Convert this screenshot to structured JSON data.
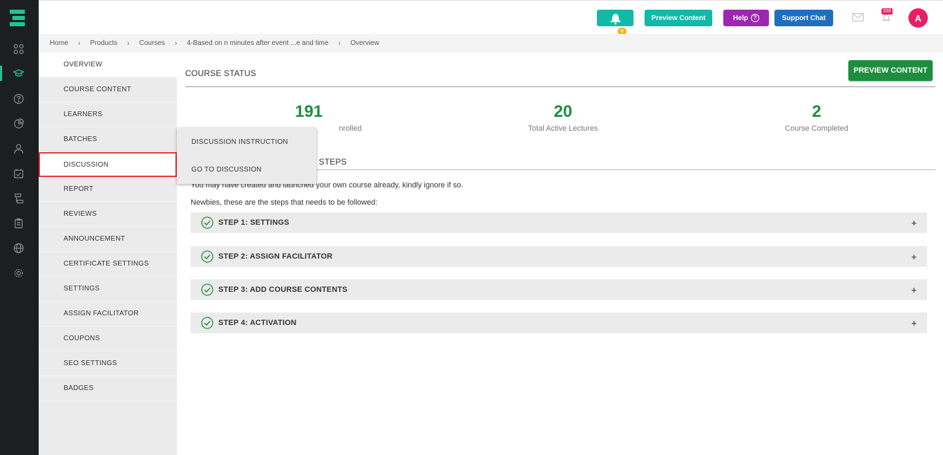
{
  "topbar": {
    "bell_count": "0",
    "preview_label": "Preview Content",
    "help_label": "Help",
    "help_q": "?",
    "support_label": "Support Chat",
    "notification_count": "339",
    "avatar_letter": "A"
  },
  "breadcrumb": [
    "Home",
    "Products",
    "Courses",
    "4-Based on n minutes after event ...e and time",
    "Overview"
  ],
  "sidemenu": [
    "OVERVIEW",
    "COURSE CONTENT",
    "LEARNERS",
    "BATCHES",
    "DISCUSSION",
    "REPORT",
    "REVIEWS",
    "ANNOUNCEMENT",
    "CERTIFICATE SETTINGS",
    "SETTINGS",
    "ASSIGN FACILITATOR",
    "COUPONS",
    "SEO SETTINGS",
    "BADGES"
  ],
  "dropdown": [
    "DISCUSSION INSTRUCTION",
    "GO TO DISCUSSION"
  ],
  "main": {
    "status_title": "COURSE STATUS",
    "preview_button": "PREVIEW CONTENT",
    "stats": [
      {
        "value": "191",
        "label": "nrolled"
      },
      {
        "value": "20",
        "label": "Total Active Lectures"
      },
      {
        "value": "2",
        "label": "Course Completed"
      }
    ],
    "steps_title": "Y STEPS",
    "intro_1": "You may have created and launched your own course already, kindly ignore if so.",
    "intro_2": "Newbies, these are the steps that needs to be followed:",
    "steps": [
      "STEP 1: SETTINGS",
      "STEP 2: ASSIGN FACILITATOR",
      "STEP 3: ADD COURSE CONTENTS",
      "STEP 4: ACTIVATION"
    ],
    "plus": "+"
  },
  "colors": {
    "accent": "#25c18c",
    "green": "#1e8e3e",
    "teal": "#14b8a6",
    "purple": "#9c27b0",
    "blue": "#1f6fbf",
    "pink": "#e91e63"
  }
}
